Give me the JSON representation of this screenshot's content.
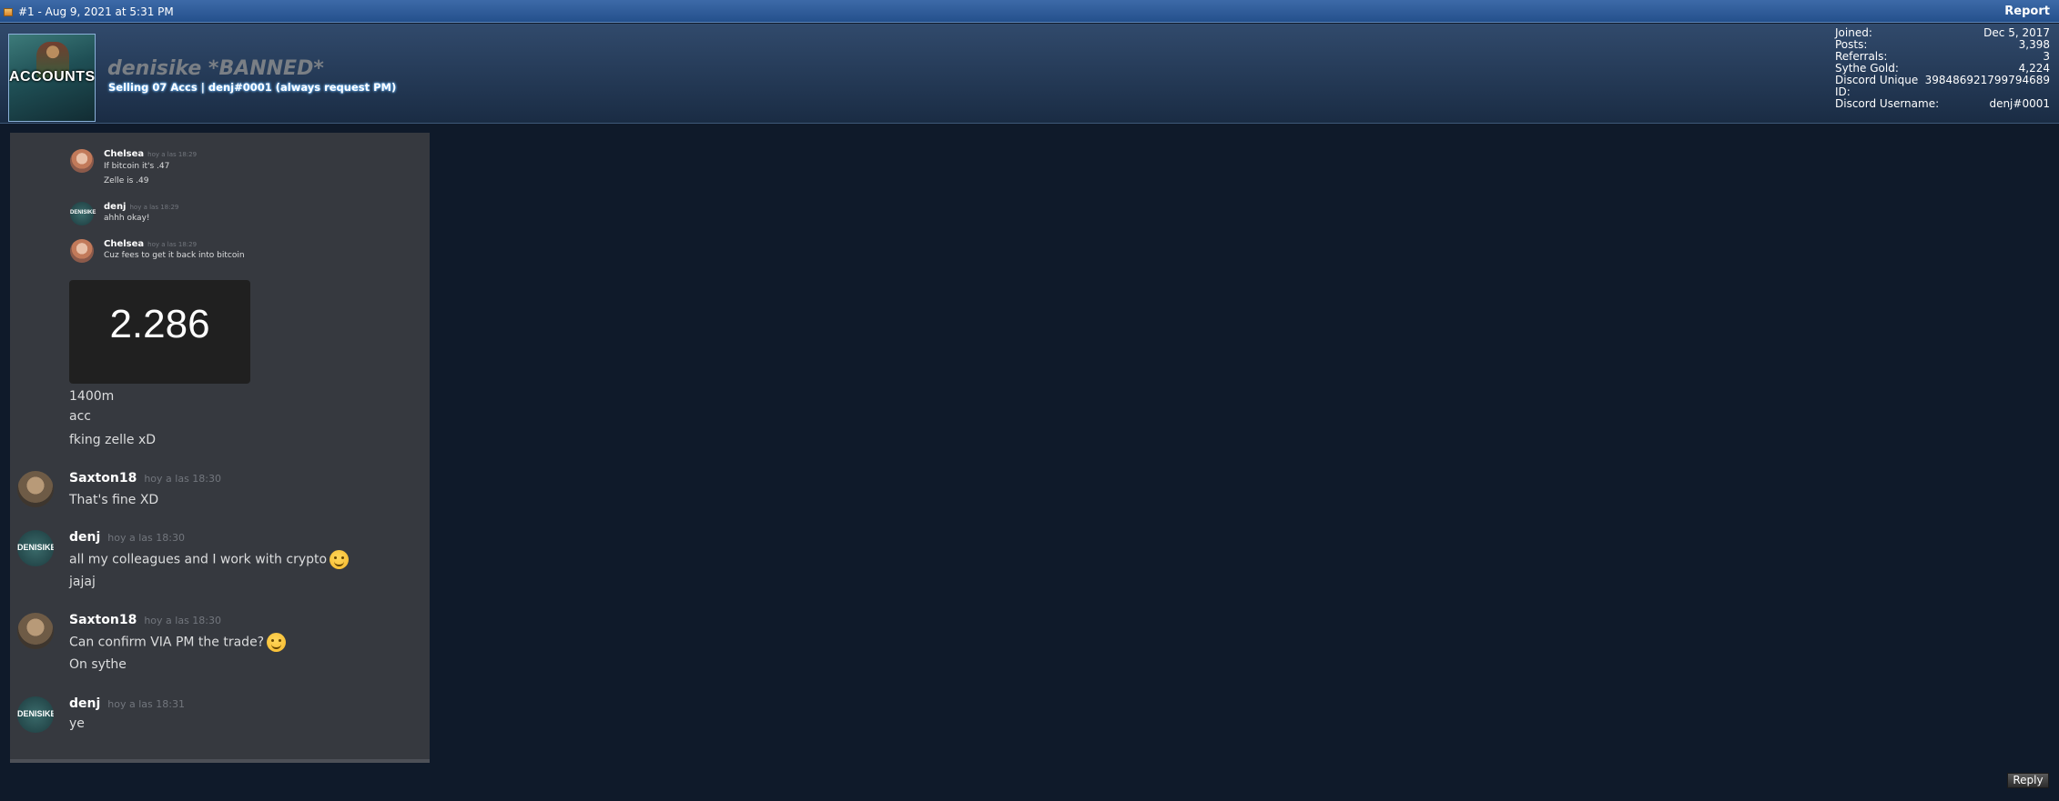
{
  "post": {
    "info": "#1 - Aug 9, 2021 at 5:31 PM",
    "report_label": "Report"
  },
  "user": {
    "avatar_text": "ACCOUNTS",
    "username": "denisike *BANNED*",
    "usertitle": "Selling 07 Accs | denj#0001 (always request PM)",
    "stats": [
      {
        "label": "Joined:",
        "value": "Dec 5, 2017"
      },
      {
        "label": "Posts:",
        "value": "3,398"
      },
      {
        "label": "Referrals:",
        "value": "3"
      },
      {
        "label": "Sythe Gold:",
        "value": "4,224"
      },
      {
        "label": "Discord Unique ID:",
        "value": "398486921799794689"
      },
      {
        "label": "Discord Username:",
        "value": "denj#0001"
      }
    ]
  },
  "chat": {
    "avatar_mini_text": "DENISIKE",
    "small_messages": [
      {
        "name": "Chelsea",
        "time": "hoy a las 18:29",
        "lines": [
          "If bitcoin it's .47",
          "Zelle is .49"
        ]
      },
      {
        "name": "denj",
        "time": "hoy a las 18:29",
        "lines": [
          "ahhh okay!"
        ]
      },
      {
        "name": "Chelsea",
        "time": "hoy a las 18:29",
        "lines": [
          "Cuz fees to get it back into bitcoin"
        ]
      }
    ],
    "embed_value": "2.286",
    "lines_after_embed": [
      "1400m",
      "acc",
      "fking zelle xD"
    ],
    "messages": [
      {
        "name": "Saxton18",
        "time": "hoy a las 18:30",
        "lines": [
          "That's fine XD"
        ]
      },
      {
        "name": "denj",
        "time": "hoy a las 18:30",
        "lines": [
          "all my colleagues and I work with crypto",
          "jajaj"
        ]
      },
      {
        "name": "Saxton18",
        "time": "hoy a las 18:30",
        "lines": [
          "Can confirm VIA PM the trade?",
          "On sythe"
        ]
      },
      {
        "name": "denj",
        "time": "hoy a las 18:31",
        "lines": [
          "ye"
        ]
      }
    ]
  },
  "reply_label": "Reply"
}
